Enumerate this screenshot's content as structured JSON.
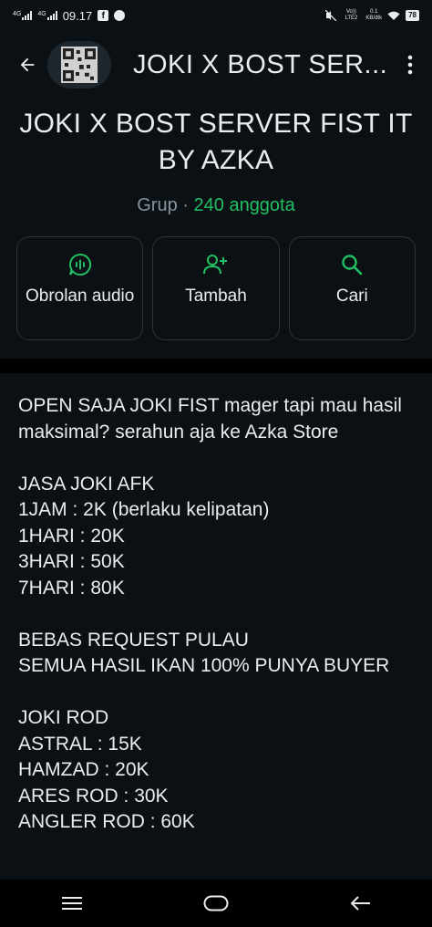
{
  "status_bar": {
    "network1": "4G",
    "network2": "4G",
    "time": "09.17",
    "volte": "Vo)) LTE2",
    "speed_value": "0.1",
    "speed_unit": "KB/dtk",
    "battery": "78"
  },
  "header": {
    "title": "JOKI X BOST SER...",
    "icons": {
      "back": "arrow-left-icon",
      "menu": "more-vert-icon"
    }
  },
  "group": {
    "name": "JOKI X BOST SERVER FIST IT BY AZKA",
    "type": "Grup",
    "separator": "·",
    "members": "240 anggota"
  },
  "actions": [
    {
      "label": "Obrolan audio",
      "icon": "audio-chat-icon"
    },
    {
      "label": "Tambah",
      "icon": "add-person-icon"
    },
    {
      "label": "Cari",
      "icon": "search-icon"
    }
  ],
  "description": "OPEN SAJA JOKI FIST mager tapi mau hasil maksimal? serahun aja ke Azka Store\n\nJASA JOKI AFK\n1JAM : 2K (berlaku kelipatan)\n1HARI : 20K\n3HARI : 50K\n7HARI : 80K\n\nBEBAS REQUEST PULAU\nSEMUA HASIL IKAN 100% PUNYA BUYER\n\nJOKI ROD\nASTRAL : 15K\nHAMZAD : 20K\nARES ROD : 30K\nANGLER ROD : 60K",
  "colors": {
    "accent": "#21c063",
    "background": "#0b1014",
    "card_border": "#2a3338"
  }
}
